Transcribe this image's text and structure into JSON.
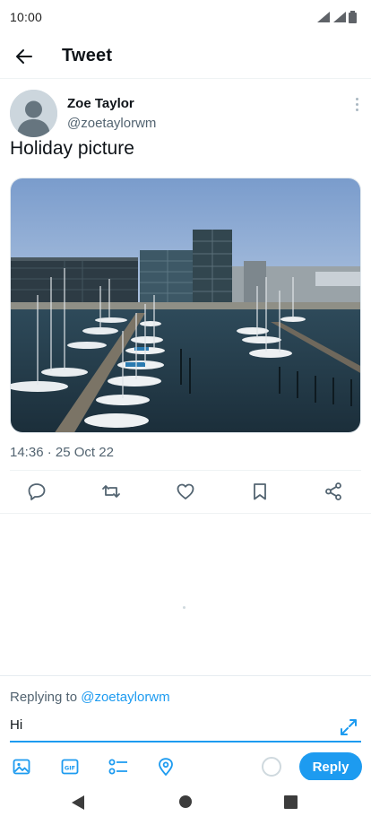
{
  "status_bar": {
    "time": "10:00",
    "icons": [
      "wifi-icon",
      "cellular-signal-icon",
      "battery-icon"
    ]
  },
  "app_bar": {
    "back_icon": "arrow-left-icon",
    "title": "Tweet"
  },
  "tweet": {
    "author_name": "Zoe Taylor",
    "author_handle": "@zoetaylorwm",
    "text": "Holiday picture",
    "media_description": "photo of a marina with sailboats and office buildings",
    "timestamp": "14:36 · 25 Oct 22",
    "actions": [
      {
        "name": "reply",
        "icon": "comment-icon"
      },
      {
        "name": "retweet",
        "icon": "retweet-icon"
      },
      {
        "name": "like",
        "icon": "heart-icon"
      },
      {
        "name": "bookmark",
        "icon": "bookmark-icon"
      },
      {
        "name": "share",
        "icon": "share-icon"
      }
    ]
  },
  "composer": {
    "replying_prefix": "Replying to",
    "replying_handle": "@zoetaylorwm",
    "input_value": "Hi",
    "tools": [
      "image-icon",
      "gif-icon",
      "poll-icon",
      "location-icon"
    ],
    "reply_label": "Reply"
  },
  "nav_bar": {
    "buttons": [
      "back-triangle-icon",
      "home-circle-icon",
      "recents-square-icon"
    ]
  },
  "colors": {
    "accent": "#1d9bf0",
    "text_primary": "#0f1419",
    "text_secondary": "#536471"
  }
}
